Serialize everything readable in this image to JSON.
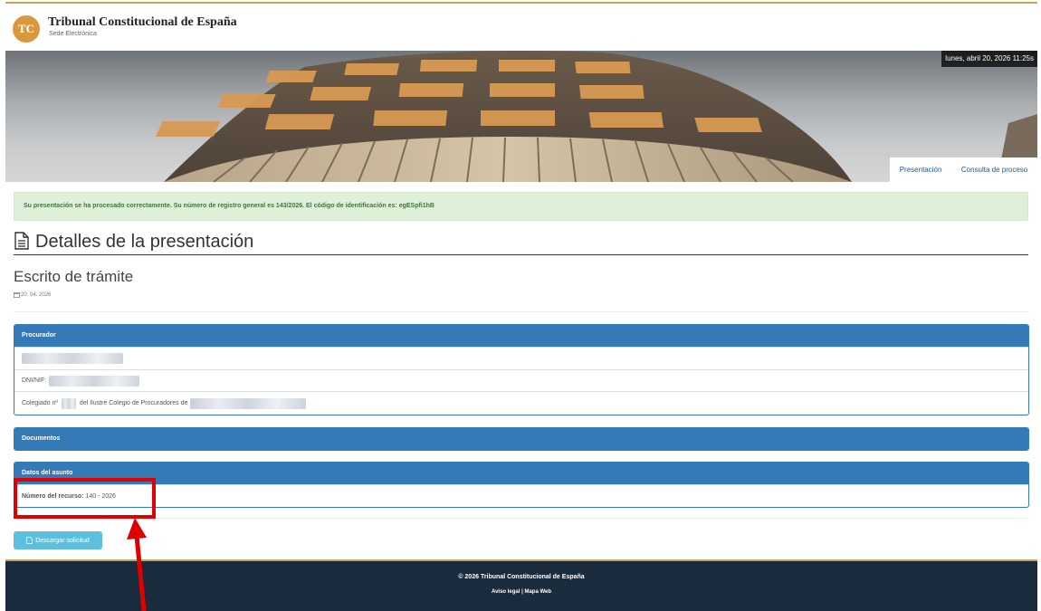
{
  "brand": {
    "logo_text": "TC",
    "name": "Tribunal Constitucional de España",
    "subtitle": "Sede Electrónica"
  },
  "banner": {
    "datetime": "lunes, abril 20, 2026 11:25s"
  },
  "nav": {
    "items": [
      "Presentación",
      "Consulta de proceso"
    ]
  },
  "alert": {
    "message": "Su presentación se ha procesado correctamente. Su número de registro general es 143/2026. El código de identificación es: egESpfi1hB"
  },
  "page": {
    "title": "Detalles de la presentación",
    "subtitle": "Escrito de trámite",
    "date": "20. 04. 2026"
  },
  "panels": {
    "procurador": {
      "heading": "Procurador",
      "dni_label": "DNI/NIF:",
      "colegiado_prefix": "Colegiado nº",
      "colegiado_middle": "del Ilustre Colegio de Procuradores de"
    },
    "documentos": {
      "heading": "Documentos"
    },
    "asunto": {
      "heading": "Datos del asunto",
      "recurso_label": "Número del recurso:",
      "recurso_value": "140 - 2026"
    }
  },
  "actions": {
    "download_label": "Descargar solicitud"
  },
  "footer": {
    "copyright": "© 2026 Tribunal Constitucional de España",
    "links": [
      "Aviso legal",
      "Mapa Web"
    ],
    "separator": "|"
  },
  "colors": {
    "primary": "#337ab7",
    "success_bg": "#dff0d8",
    "success_text": "#3c763d",
    "info_button": "#5bc0de",
    "footer_bg": "#1a2b3e",
    "gold": "#c9a253",
    "annotation": "#e00000"
  },
  "icons": {
    "title": "file-text-icon",
    "date": "calendar-icon",
    "download": "file-icon"
  }
}
